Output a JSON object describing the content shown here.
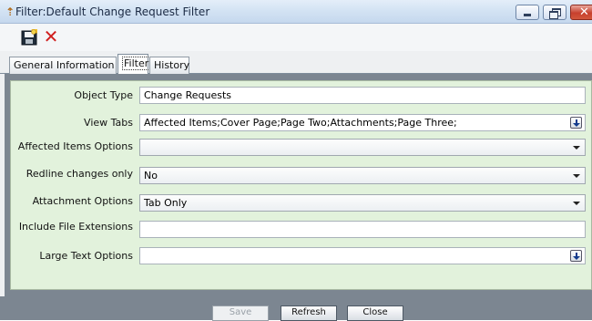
{
  "window": {
    "title": "Filter:Default Change Request Filter"
  },
  "toolbar": {
    "save_icon": "save-icon",
    "delete_icon": "delete-icon"
  },
  "tabs": [
    {
      "label": "General Information",
      "active": false
    },
    {
      "label": "Filter",
      "active": true
    },
    {
      "label": "History",
      "active": false
    }
  ],
  "form": {
    "object_type": {
      "label": "Object Type",
      "value": "Change Requests"
    },
    "view_tabs": {
      "label": "View Tabs",
      "value": "Affected Items;Cover Page;Page Two;Attachments;Page Three;"
    },
    "affected_items_options": {
      "label": "Affected Items Options",
      "value": ""
    },
    "redline_changes_only": {
      "label": "Redline changes only",
      "value": "No"
    },
    "attachment_options": {
      "label": "Attachment Options",
      "value": "Tab Only"
    },
    "include_file_extensions": {
      "label": "Include File Extensions",
      "value": ""
    },
    "large_text_options": {
      "label": "Large Text Options",
      "value": ""
    }
  },
  "buttons": {
    "save": "Save",
    "refresh": "Refresh",
    "close": "Close"
  },
  "colors": {
    "panel_bg": "#e2f2dc",
    "frame_bg": "#7c8691",
    "delete_red": "#d01f1f"
  }
}
